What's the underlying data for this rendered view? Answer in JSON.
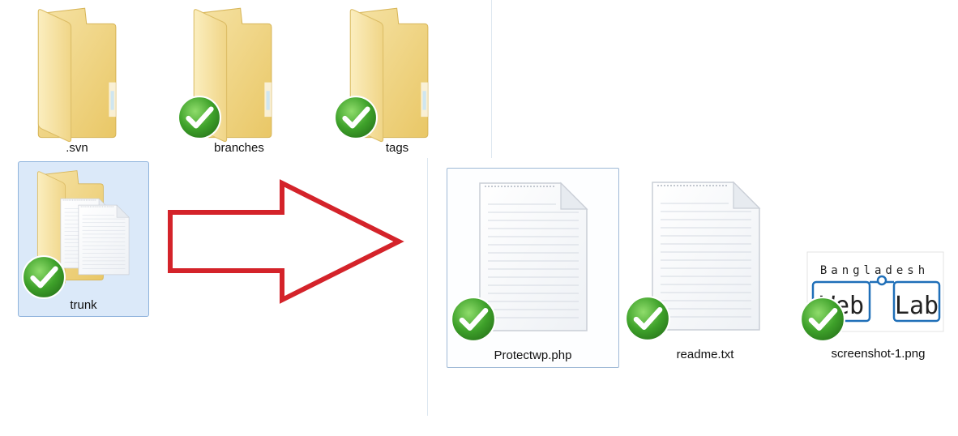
{
  "explorer_left": {
    "folders": [
      {
        "name": ".svn",
        "svn_status": "none"
      },
      {
        "name": "branches",
        "svn_status": "normal"
      },
      {
        "name": "tags",
        "svn_status": "normal"
      },
      {
        "name": "trunk",
        "svn_status": "normal",
        "selected": true
      }
    ]
  },
  "explorer_right": {
    "files": [
      {
        "name": "Protectwp.php",
        "svn_status": "normal",
        "highlighted": true
      },
      {
        "name": "readme.txt",
        "svn_status": "normal"
      },
      {
        "name": "screenshot-1.png",
        "svn_status": "normal"
      }
    ]
  },
  "thumbnail": {
    "line1": "Bangladesh",
    "line2_left": "Web",
    "line2_right": "Lab"
  },
  "colors": {
    "folder": "#f2d37a",
    "check_green": "#3ea12a",
    "arrow_red": "#d4232a",
    "selection": "#dbe9f9",
    "logo_blue": "#1f6fb8"
  },
  "icons": [
    "folder-icon",
    "svn-normal-overlay-icon",
    "text-file-icon",
    "image-thumbnail-icon",
    "right-arrow-icon"
  ]
}
